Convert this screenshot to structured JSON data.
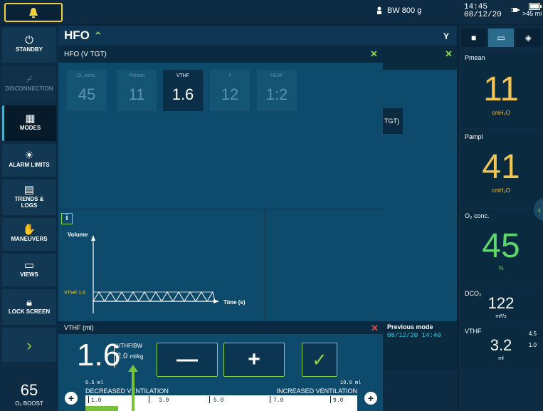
{
  "topbar": {
    "alarm_icon": "bell-icon",
    "bw_label": "BW 800 g",
    "time": "14:45",
    "date": "08/12/20",
    "battery_label": ">45 mi"
  },
  "sidebar": {
    "standby": "STANDBY",
    "disconnection": "DISCONNECTION",
    "modes": "MODES",
    "alarm_limits": "ALARM LIMITS",
    "trends_logs_1": "TRENDS &",
    "trends_logs_2": "LOGS",
    "maneuvers": "MANEUVERS",
    "views": "VIEWS",
    "lock_screen": "LOCK SCREEN",
    "o2boost_value": "65",
    "o2boost_label": "O₂ BOOST"
  },
  "header": {
    "mode": "HFO",
    "y_label": "Y"
  },
  "overlay": {
    "title": "HFO (V TGT)",
    "params": [
      {
        "label": "O₂ conc.",
        "value": "45"
      },
      {
        "label": "Pmean",
        "value": "11"
      },
      {
        "label": "VTHF",
        "value": "1.6"
      },
      {
        "label": "f",
        "value": "12"
      },
      {
        "label": "I:EHF",
        "value": "1:2"
      }
    ],
    "info": "i",
    "graph": {
      "ylabel": "Volume",
      "xlabel": "Time (s)",
      "baseline_label": "VTHF 1.6"
    },
    "tgt_fragment": "TGT)"
  },
  "adjust": {
    "title": "VTHF (ml)",
    "value": "1.6",
    "vtbw_label": "VTHF/BW",
    "vtbw_value": "2.0",
    "vtbw_unit": "ml/kg",
    "min_label": "0.5 ml",
    "max_label": "10.0 ml",
    "decreased": "DECREASED VENTILATION",
    "increased": "INCREASED VENTILATION",
    "ticks": [
      "1.0",
      "3.0",
      "5.0",
      "7.0",
      "9.0"
    ],
    "minus": "—",
    "plus": "+",
    "confirm": "✓"
  },
  "previous_mode": {
    "title": "Previous mode",
    "datetime": "08/12/20 14:40"
  },
  "monitors": [
    {
      "label": "Pmean",
      "value": "11",
      "unit": "cmH₂O",
      "color": "#f3c452"
    },
    {
      "label": "Pampl",
      "value": "41",
      "unit": "cmH₂O",
      "color": "#f3c452"
    },
    {
      "label": "O₂ conc.",
      "value": "45",
      "unit": "%",
      "color": "#5ed66b"
    },
    {
      "label": "DCO₂",
      "value": "122",
      "unit": "ml²/s",
      "color": "#ffffff"
    },
    {
      "label": "VTHF",
      "value": "3.2",
      "unit": "ml",
      "color": "#ffffff",
      "high": "4.5",
      "low": "1.0"
    }
  ],
  "colors": {
    "accent_green": "#8cd448",
    "cyan": "#2ed0e6",
    "alarm_yellow": "#f3d03e"
  }
}
